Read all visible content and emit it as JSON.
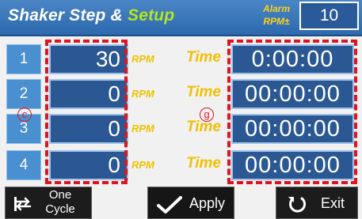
{
  "header": {
    "title_main": "Shaker Step  & ",
    "title_accent": "Setup",
    "alarm_label_line1": "Alarm",
    "alarm_label_line2": "RPM±",
    "alarm_value": "10"
  },
  "steps": [
    {
      "number": "1",
      "rpm": "30",
      "rpm_unit": "RPM",
      "time_label": "Time",
      "time": "0:00:00"
    },
    {
      "number": "2",
      "rpm": "0",
      "rpm_unit": "RPM",
      "time_label": "Time",
      "time": "00:00:00"
    },
    {
      "number": "3",
      "rpm": "0",
      "rpm_unit": "RPM",
      "time_label": "Time",
      "time": "00:00:00"
    },
    {
      "number": "4",
      "rpm": "0",
      "rpm_unit": "RPM",
      "time_label": "Time",
      "time": "00:00:00"
    }
  ],
  "annotations": {
    "marker_c": "c",
    "marker_g": "g"
  },
  "buttons": {
    "one_cycle_line1": "One",
    "one_cycle_line2": "Cycle",
    "apply": "Apply",
    "exit": "Exit"
  },
  "colors": {
    "header_bg": "#2c69ad",
    "title_accent": "#b5e61d",
    "label_yellow": "#f0c000",
    "field_bg": "#2b5893",
    "annotation_red": "#e0141e"
  },
  "icons": {
    "one_cycle": "repeat-icon",
    "apply": "checkmark-icon",
    "exit": "return-arrow-icon"
  }
}
